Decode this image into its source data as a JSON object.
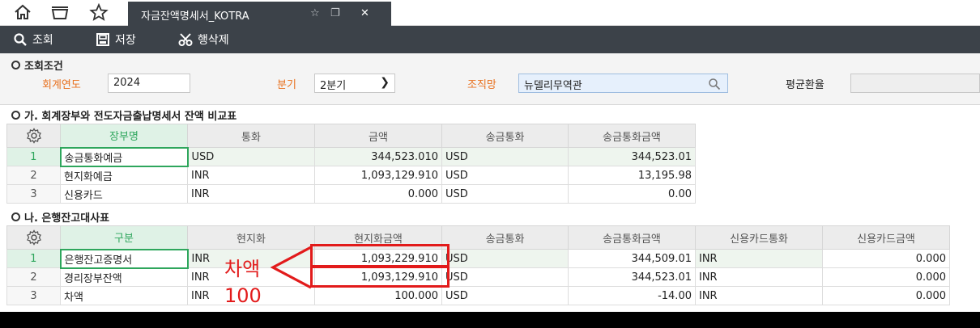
{
  "tab": {
    "title": "자금잔액명세서_KOTRA"
  },
  "toolbar": {
    "search_label": "조회",
    "save_label": "저장",
    "delete_row_label": "행삭제"
  },
  "conditions": {
    "section_title": "조회조건",
    "fiscal_year_label": "회계연도",
    "fiscal_year_value": "2024",
    "quarter_label": "분기",
    "quarter_value": "2분기",
    "org_label": "조직망",
    "org_value": "뉴델리무역관",
    "avg_rate_label": "평균환율",
    "avg_rate_value": ""
  },
  "section_a": {
    "title": "가. 회계장부와 전도자금출납명세서 잔액 비교표",
    "columns": [
      "장부명",
      "통화",
      "금액",
      "송금통화",
      "송금통화금액"
    ],
    "rows": [
      {
        "no": "1",
        "name": "송금통화예금",
        "currency": "USD",
        "amount": "344,523.010",
        "remit_currency": "USD",
        "remit_amount": "344,523.01"
      },
      {
        "no": "2",
        "name": "현지화예금",
        "currency": "INR",
        "amount": "1,093,129.910",
        "remit_currency": "USD",
        "remit_amount": "13,195.98"
      },
      {
        "no": "3",
        "name": "신용카드",
        "currency": "INR",
        "amount": "0.000",
        "remit_currency": "USD",
        "remit_amount": "0.00"
      }
    ]
  },
  "section_b": {
    "title": "나. 은행잔고대사표",
    "columns": [
      "구분",
      "현지화",
      "현지화금액",
      "송금통화",
      "송금통화금액",
      "신용카드통화",
      "신용카드금액"
    ],
    "rows": [
      {
        "no": "1",
        "name": "은행잔고증명서",
        "local": "INR",
        "local_amount": "1,093,229.910",
        "remit_currency": "USD",
        "remit_amount": "344,509.01",
        "card_currency": "INR",
        "card_amount": "0.000"
      },
      {
        "no": "2",
        "name": "경리장부잔액",
        "local": "INR",
        "local_amount": "1,093,129.910",
        "remit_currency": "USD",
        "remit_amount": "344,523.01",
        "card_currency": "INR",
        "card_amount": "0.000"
      },
      {
        "no": "3",
        "name": "차액",
        "local": "INR",
        "local_amount": "100.000",
        "remit_currency": "USD",
        "remit_amount": "-14.00",
        "card_currency": "INR",
        "card_amount": "0.000"
      }
    ]
  },
  "annotation": {
    "label": "차액",
    "value": "100"
  },
  "colors": {
    "accent_green": "#2ea65c",
    "annotation_red": "#e21b1b",
    "required_orange": "#e8711f",
    "dark_bar": "#3c4249"
  }
}
